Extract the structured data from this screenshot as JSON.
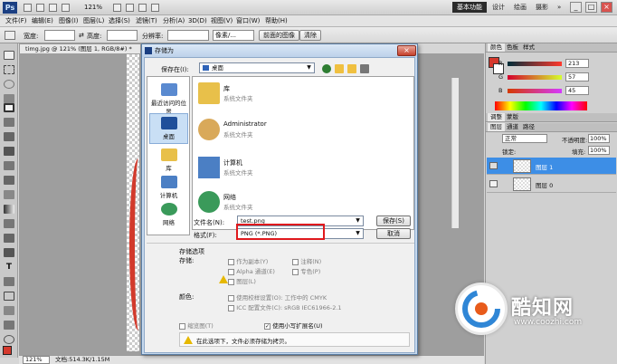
{
  "titlebar": {
    "logo": "Ps",
    "zoom": "121%",
    "workspaces": [
      "基本功能",
      "设计",
      "绘画",
      "摄影"
    ],
    "more": "»"
  },
  "menubar": [
    "文件(F)",
    "编辑(E)",
    "图像(I)",
    "图层(L)",
    "选择(S)",
    "滤镜(T)",
    "分析(A)",
    "3D(D)",
    "视图(V)",
    "窗口(W)",
    "帮助(H)"
  ],
  "options": {
    "width_label": "宽度:",
    "height_label": "高度:",
    "resolution_label": "分辨率:",
    "resolution_unit": "像素/...",
    "front_image_button": "前面的图像",
    "clear_button": "清除"
  },
  "document": {
    "tab": "timg.jpg @ 121% (图层 1, RGB/8#) *",
    "status_zoom": "121%",
    "status_doc": "文档:514.3K/1.15M"
  },
  "panels": {
    "color_tabs": [
      "颜色",
      "色板",
      "样式"
    ],
    "rgb": [
      {
        "label": "R",
        "value": "213"
      },
      {
        "label": "G",
        "value": "57"
      },
      {
        "label": "B",
        "value": "45"
      }
    ],
    "fg_color": "#d5392d",
    "adjust_tabs": [
      "调整",
      "蒙版"
    ],
    "layers_tabs": [
      "图层",
      "通道",
      "路径"
    ],
    "blend_mode": "正常",
    "opacity_label": "不透明度:",
    "opacity": "100%",
    "lock_label": "锁定:",
    "fill_label": "填充:",
    "fill": "100%",
    "layers": [
      {
        "name": "图层 1",
        "selected": true
      },
      {
        "name": "图层 0",
        "selected": false
      }
    ]
  },
  "dialog": {
    "title": "存储为",
    "save_in_label": "保存在(I):",
    "save_in_value": "桌面",
    "places": [
      "最近访问的位置",
      "桌面",
      "库",
      "计算机",
      "网络"
    ],
    "files": [
      {
        "name": "库",
        "sub": "系统文件夹"
      },
      {
        "name": "Administrator",
        "sub": "系统文件夹"
      },
      {
        "name": "计算机",
        "sub": "系统文件夹"
      },
      {
        "name": "网络",
        "sub": "系统文件夹"
      }
    ],
    "filename_label": "文件名(N):",
    "filename_value": "test.png",
    "format_label": "格式(F):",
    "format_value": "PNG (*.PNG)",
    "save_button": "保存(S)",
    "cancel_button": "取消",
    "save_options_title": "存储选项",
    "save_label": "存储:",
    "save_options": [
      "作为副本(Y)",
      "注释(N)",
      "Alpha 通道(E)",
      "专色(P)",
      "图层(L)"
    ],
    "color_label": "颜色:",
    "proof_setup": "使用校样设置(O):  工作中的 CMYK",
    "icc_profile": "ICC 配置文件(C):  sRGB IEC61966-2.1",
    "thumbnail": "缩览图(T)",
    "lowercase_ext": "使用小写扩展名(U)",
    "warning": "在此选项下，文件必须存储为拷贝。"
  },
  "watermark": {
    "title": "酷知网",
    "url": "www.coozhi.com"
  }
}
